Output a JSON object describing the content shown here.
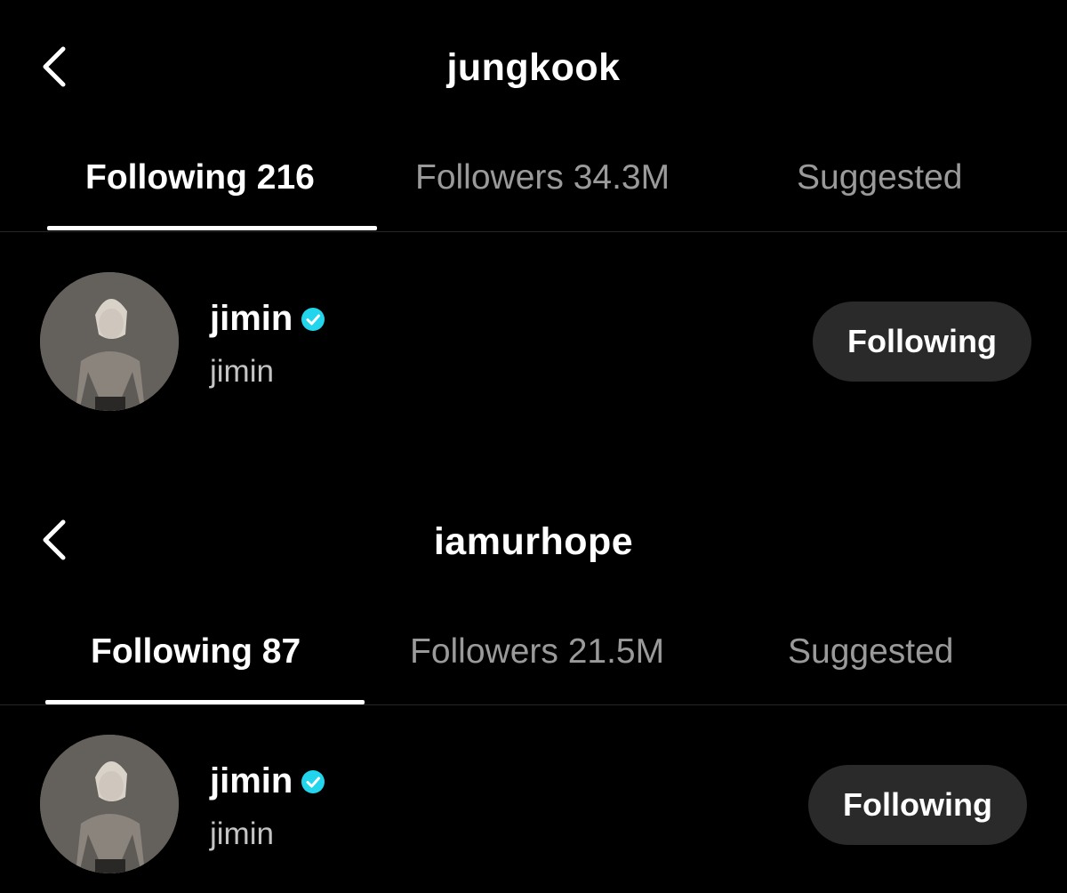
{
  "panels": [
    {
      "title": "jungkook",
      "tabs": [
        {
          "label": "Following 216",
          "active": true
        },
        {
          "label": "Followers 34.3M",
          "active": false
        },
        {
          "label": "Suggested",
          "active": false
        }
      ],
      "user": {
        "username": "jimin",
        "handle": "jimin",
        "verified": true,
        "button_label": "Following"
      }
    },
    {
      "title": "iamurhope",
      "tabs": [
        {
          "label": "Following 87",
          "active": true
        },
        {
          "label": "Followers 21.5M",
          "active": false
        },
        {
          "label": "Suggested",
          "active": false
        }
      ],
      "user": {
        "username": "jimin",
        "handle": "jimin",
        "verified": true,
        "button_label": "Following"
      }
    }
  ],
  "icons": {
    "back": "chevron-left-icon",
    "verified": "verified-badge-icon"
  },
  "colors": {
    "background": "#000000",
    "active_tab": "#ffffff",
    "inactive_tab": "#9a9a9a",
    "button_bg": "#2a2a2a",
    "verified": "#20d5ec"
  }
}
